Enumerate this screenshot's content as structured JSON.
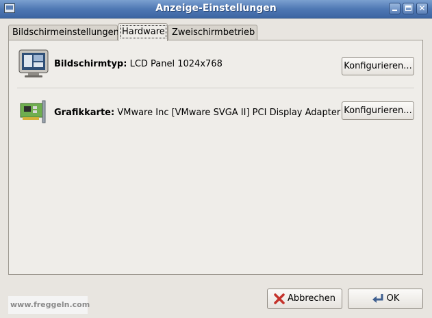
{
  "window": {
    "title": "Anzeige-Einstellungen",
    "icon": "display-settings-icon",
    "controls": [
      "minimize-icon",
      "maximize-icon",
      "close-icon"
    ]
  },
  "tabs": [
    {
      "label": "Bildschirmeinstellungen",
      "active": false
    },
    {
      "label": "Hardware",
      "active": true
    },
    {
      "label": "Zweischirmbetrieb",
      "active": false
    }
  ],
  "hardware": {
    "monitor": {
      "icon": "monitor-icon",
      "label": "Bildschirmtyp:",
      "value": "LCD Panel 1024x768",
      "button": "Konfigurieren..."
    },
    "graphics": {
      "icon": "graphics-card-icon",
      "label": "Grafikkarte:",
      "value": "VMware Inc [VMware SVGA II] PCI Display Adapter",
      "button": "Konfigurieren..."
    }
  },
  "footer": {
    "watermark": "www.freggeln.com",
    "cancel_label": "Abbrechen",
    "cancel_icon": "cancel-x-icon",
    "ok_label": "OK",
    "ok_icon": "ok-enter-icon"
  },
  "colors": {
    "titlebar": "#4f78b4",
    "background": "#e8e5e0",
    "panel": "#efede9",
    "cancel_icon": "#c4322b"
  }
}
